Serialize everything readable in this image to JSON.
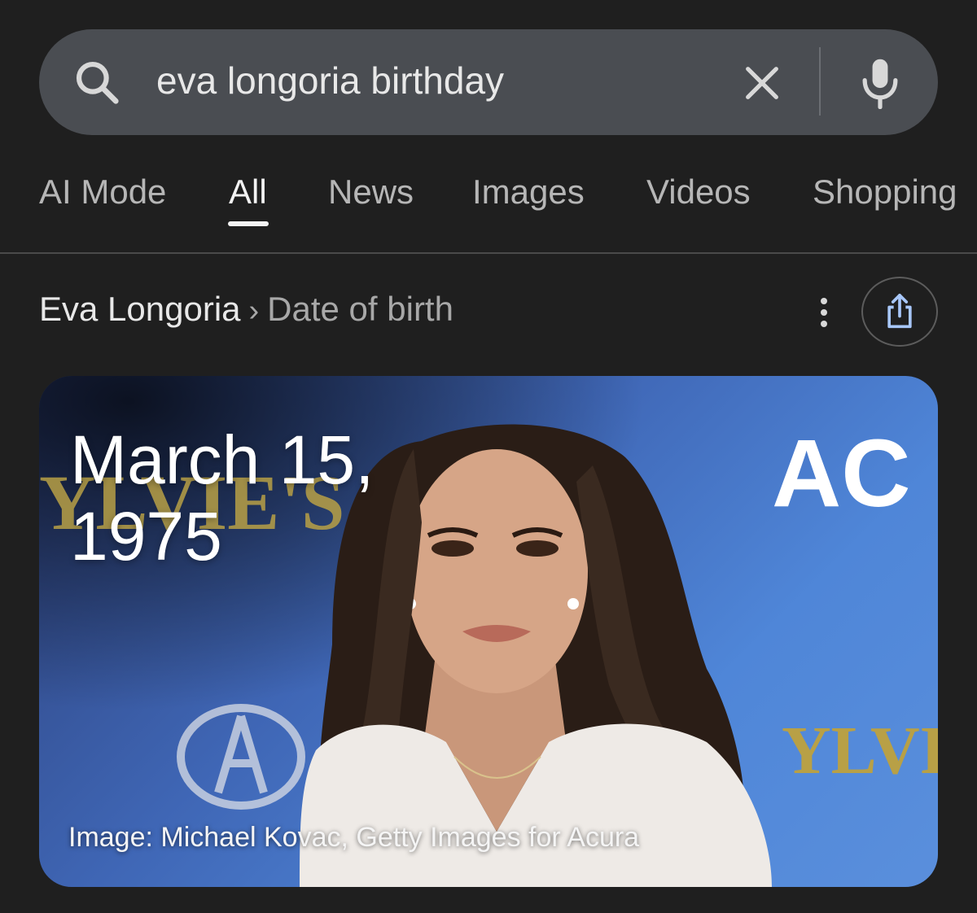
{
  "search": {
    "query": "eva longoria birthday",
    "clear_icon": "close-icon",
    "mic_icon": "mic-icon",
    "search_icon": "search-icon"
  },
  "tabs": [
    {
      "label": "AI Mode",
      "active": false
    },
    {
      "label": "All",
      "active": true
    },
    {
      "label": "News",
      "active": false
    },
    {
      "label": "Images",
      "active": false
    },
    {
      "label": "Videos",
      "active": false
    },
    {
      "label": "Shopping",
      "active": false
    }
  ],
  "breadcrumb": {
    "entity": "Eva Longoria",
    "separator": "›",
    "attribute": "Date of birth"
  },
  "answer": {
    "date_line1": "March 15,",
    "date_line2": "1975",
    "image_caption": "Image: Michael Kovac, Getty Images for Acura",
    "backdrop_texts": [
      "YLVIE'S L",
      "AC",
      "YLVI"
    ]
  },
  "colors": {
    "background": "#1f1f1f",
    "search_bar": "#4a4d52",
    "share_icon": "#a8c7fa"
  }
}
